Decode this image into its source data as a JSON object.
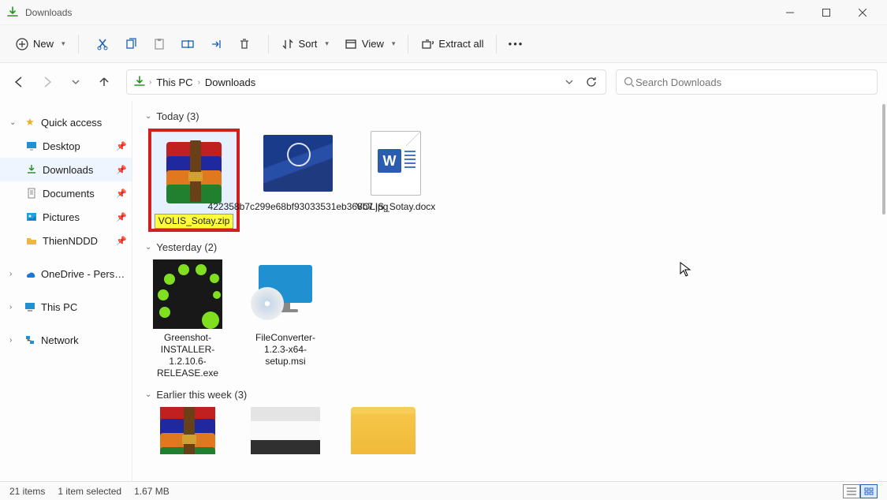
{
  "window": {
    "title": "Downloads"
  },
  "toolbar": {
    "new": "New",
    "sort": "Sort",
    "view": "View",
    "extract_all": "Extract all"
  },
  "breadcrumb": {
    "root": "This PC",
    "current": "Downloads"
  },
  "search": {
    "placeholder": "Search Downloads"
  },
  "sidebar": {
    "quick_access": "Quick access",
    "desktop": "Desktop",
    "downloads": "Downloads",
    "documents": "Documents",
    "pictures": "Pictures",
    "thiennddd": "ThienNDDD",
    "onedrive": "OneDrive - Personal",
    "thispc": "This PC",
    "network": "Network"
  },
  "groups": {
    "today": {
      "label": "Today (3)"
    },
    "yesterday": {
      "label": "Yesterday (2)"
    },
    "earlier_week": {
      "label": "Earlier this week (3)"
    }
  },
  "files": {
    "today": [
      {
        "name": "VOLIS_Sotay.zip"
      },
      {
        "name": "422358b7c299e68bf93033531eb368b7.jpg"
      },
      {
        "name": "VOLIS_Sotay.docx"
      }
    ],
    "yesterday": [
      {
        "name": "Greenshot-INSTALLER-1.2.10.6-RELEASE.exe"
      },
      {
        "name": "FileConverter-1.2.3-x64-setup.msi"
      }
    ]
  },
  "status": {
    "count": "21 items",
    "selected": "1 item selected",
    "size": "1.67 MB"
  }
}
